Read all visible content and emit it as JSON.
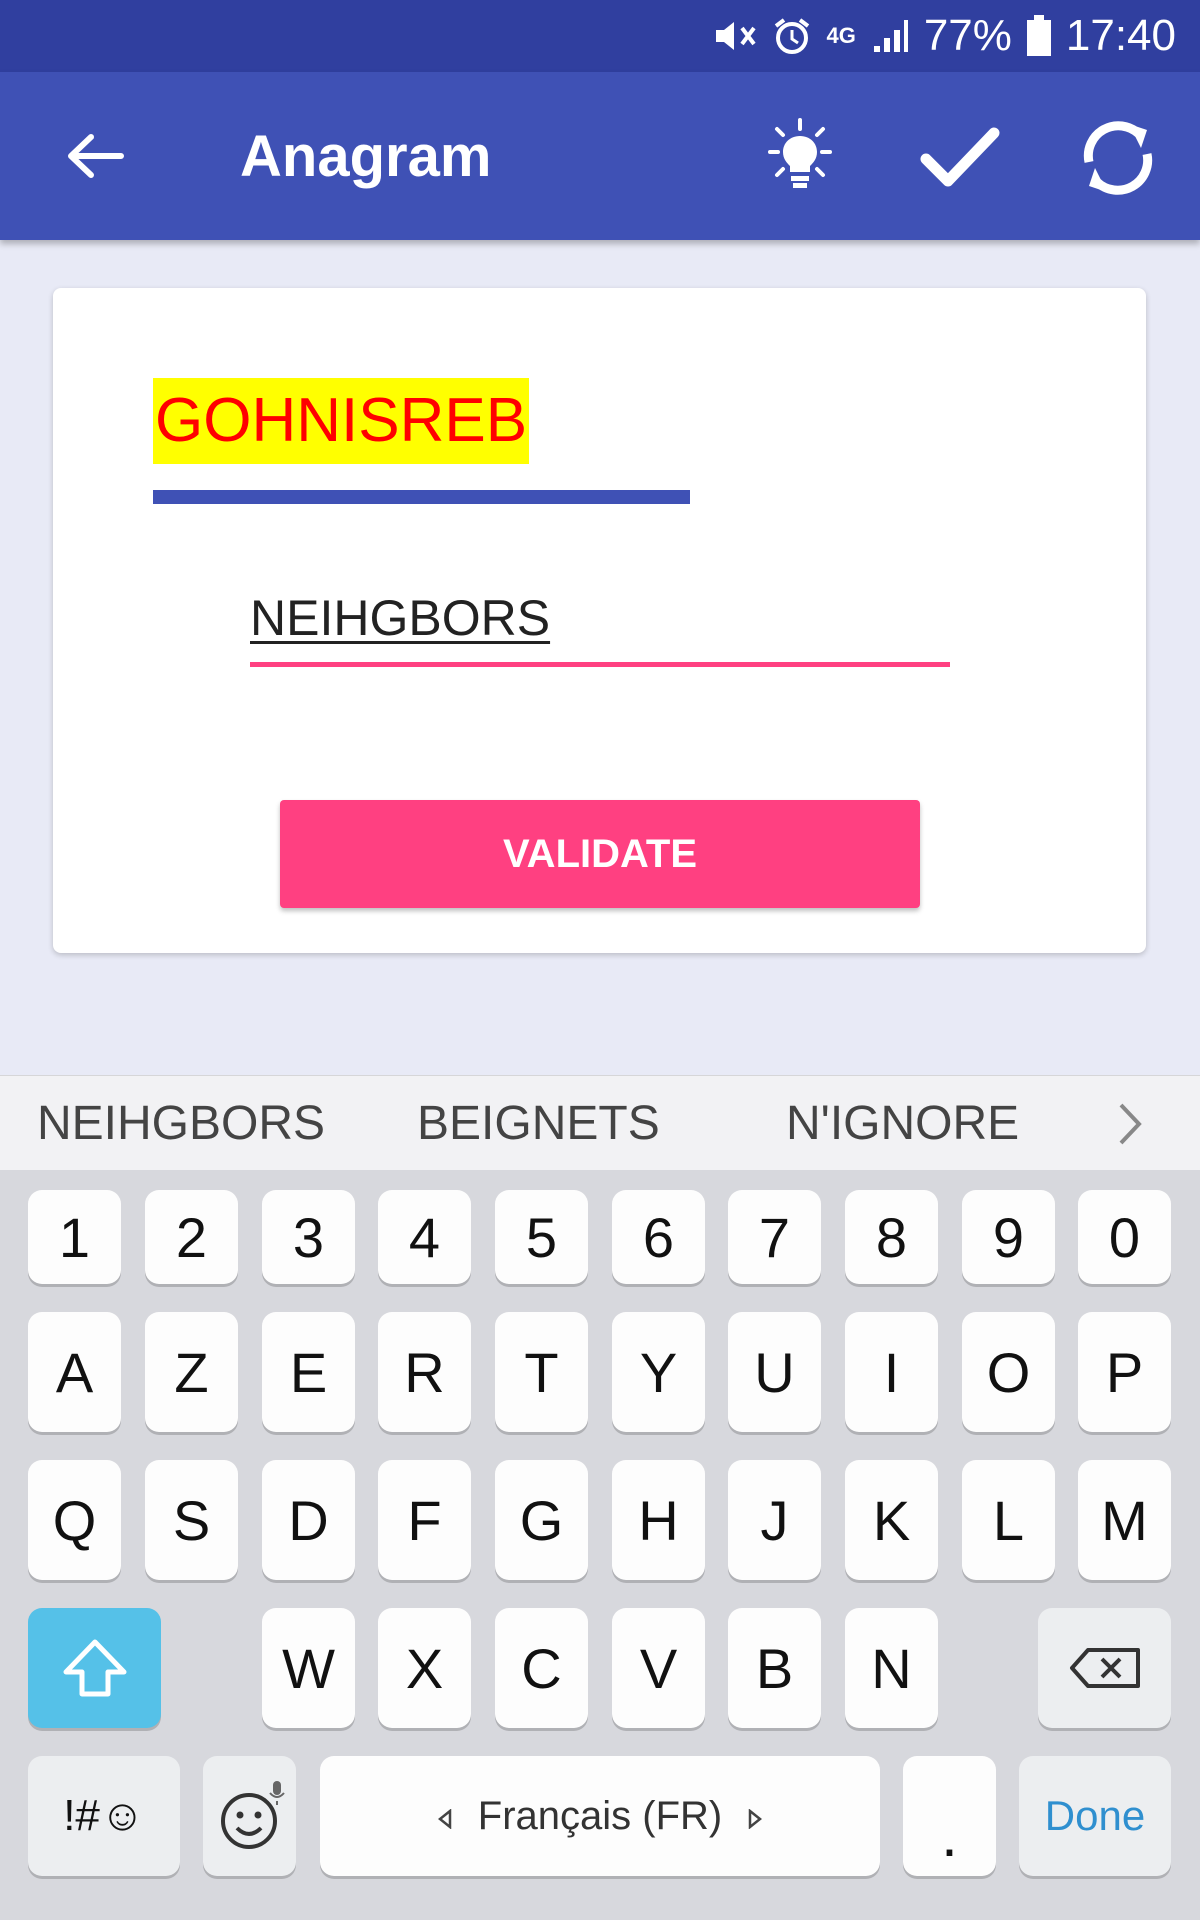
{
  "status_bar": {
    "battery": "77%",
    "time": "17:40",
    "network": "4G"
  },
  "app_bar": {
    "title": "Anagram",
    "icons": [
      "back-arrow-icon",
      "lightbulb-icon",
      "checkmark-icon",
      "refresh-icon"
    ]
  },
  "puzzle": {
    "scrambled_word": "GOHNISREB",
    "answer_value": "NEIHGBORS",
    "validate_label": "VALIDATE"
  },
  "suggestions": [
    "NEIHGBORS",
    "BEIGNETS",
    "N'IGNORE"
  ],
  "keyboard": {
    "row_numbers": [
      "1",
      "2",
      "3",
      "4",
      "5",
      "6",
      "7",
      "8",
      "9",
      "0"
    ],
    "row1": [
      "A",
      "Z",
      "E",
      "R",
      "T",
      "Y",
      "U",
      "I",
      "O",
      "P"
    ],
    "row2": [
      "Q",
      "S",
      "D",
      "F",
      "G",
      "H",
      "J",
      "K",
      "L",
      "M"
    ],
    "row3": [
      "W",
      "X",
      "C",
      "V",
      "B",
      "N"
    ],
    "symbols_label": "!#☺",
    "language_label": "Français (FR)",
    "period_label": ".",
    "done_label": "Done"
  },
  "colors": {
    "status_bar": "#303f9f",
    "app_bar": "#3f51b5",
    "accent": "#ff4081",
    "highlight": "#ffff00",
    "scrambled_text": "#ff0000",
    "shift_key": "#55c1e8"
  }
}
